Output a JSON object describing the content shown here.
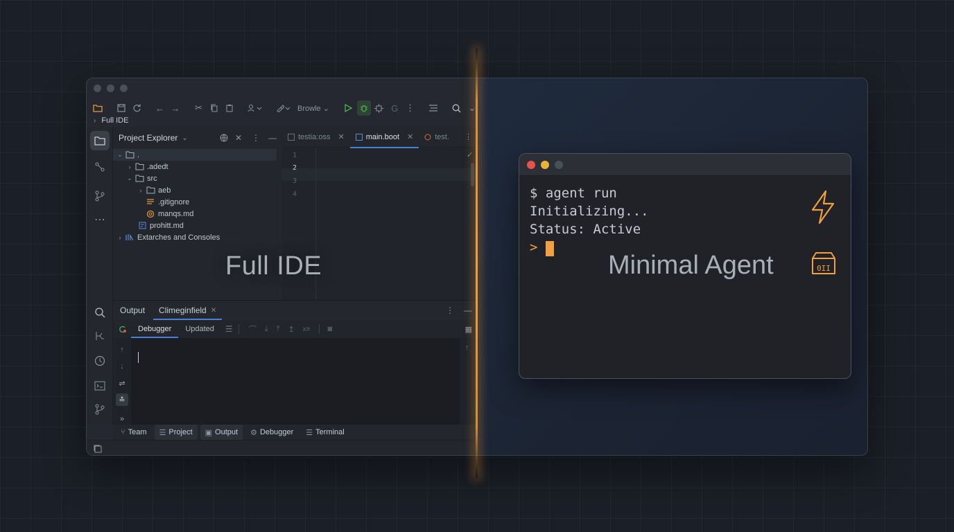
{
  "breadcrumb": {
    "label": "Full IDE"
  },
  "toolbar": {
    "run_config_label": "Browle"
  },
  "explorer": {
    "title": "Project Explorer",
    "tree": [
      {
        "label": ".",
        "kind": "folder",
        "expanded": true
      },
      {
        "label": ".adedt",
        "kind": "folder",
        "expanded": false
      },
      {
        "label": "src",
        "kind": "folder",
        "expanded": true
      },
      {
        "label": "aeb",
        "kind": "folder",
        "expanded": false
      },
      {
        "label": ".gitignore",
        "kind": "file"
      },
      {
        "label": "manqs.md",
        "kind": "file"
      },
      {
        "label": "prohitt.md",
        "kind": "file"
      },
      {
        "label": "Extarches and Consoles",
        "kind": "library",
        "expanded": false
      }
    ]
  },
  "editor": {
    "tabs": [
      {
        "label": "testia:oss",
        "active": false
      },
      {
        "label": "main.boot",
        "active": true
      },
      {
        "label": "test.",
        "active": false
      }
    ],
    "line_numbers": [
      "1",
      "2",
      "3",
      "4"
    ],
    "current_line": 2
  },
  "overlay_labels": {
    "left": "Full IDE",
    "right": "Minimal Agent"
  },
  "panel": {
    "tabs": [
      {
        "label": "Output",
        "active": false
      },
      {
        "label": "Climeginfield",
        "active": true
      }
    ],
    "sub_tabs": [
      {
        "label": "Debugger",
        "active": true
      },
      {
        "label": "Updated",
        "active": false
      }
    ]
  },
  "status_tabs": [
    {
      "label": "Team",
      "icon": "branch-icon"
    },
    {
      "label": "Project",
      "icon": "list-icon"
    },
    {
      "label": "Output",
      "icon": "output-icon"
    },
    {
      "label": "Debugger",
      "icon": "bug-icon"
    },
    {
      "label": "Terminal",
      "icon": "list-icon"
    }
  ],
  "terminal": {
    "lines": [
      "$ agent run",
      "Initializing...",
      "Status: Active",
      ">"
    ],
    "dot_colors": [
      "#e5534b",
      "#e8b339",
      "#4a4f59"
    ],
    "accent": "#f0a040"
  },
  "colors": {
    "accent_orange": "#f0a040",
    "accent_blue": "#4b7fd1",
    "run_green": "#4caf50"
  }
}
